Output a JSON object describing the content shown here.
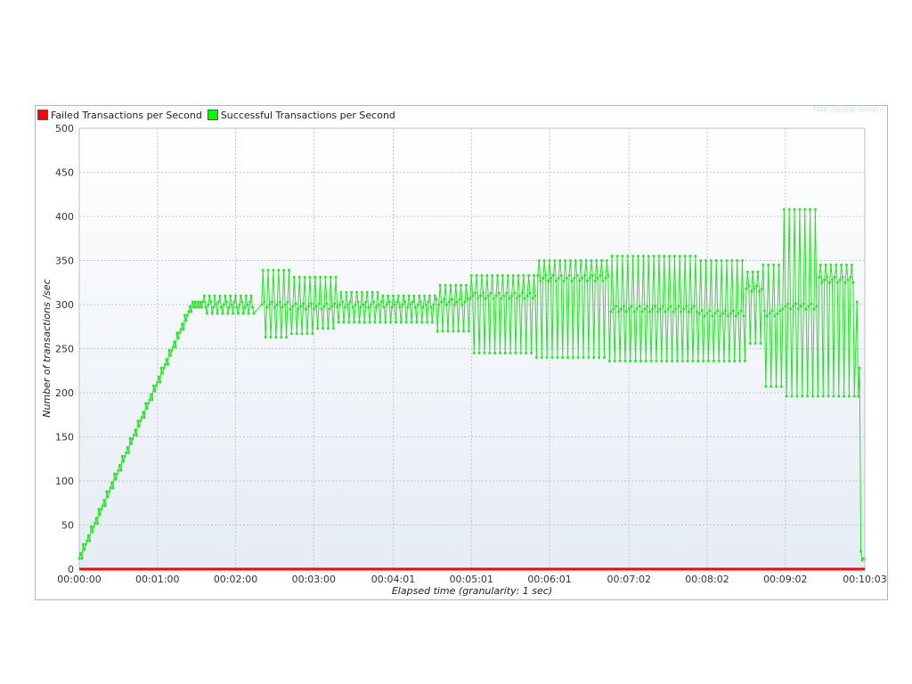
{
  "legend": {
    "failed": "Failed Transactions per Second",
    "successful": "Successful Transactions per Second"
  },
  "watermark": "http://jp@gc/plugins",
  "colors": {
    "failed": "#ff0000",
    "successful": "#00ff00",
    "successful_line": "#22e622",
    "plot_bg_top": "#ffffff",
    "plot_bg_bottom": "#e6ecf5",
    "grid": "#c4c8cc"
  },
  "chart_data": {
    "type": "line",
    "title": "",
    "xlabel": "Elapsed time (granularity: 1 sec)",
    "ylabel": "Number of transactions /sec",
    "ylim": [
      0,
      500
    ],
    "xlim_seconds": [
      0,
      603
    ],
    "grid": true,
    "legend_position": "top-left",
    "y_ticks": [
      "0",
      "50",
      "100",
      "150",
      "200",
      "250",
      "300",
      "350",
      "400",
      "450",
      "500"
    ],
    "x_ticks": [
      {
        "label": "00:00:00",
        "t": 0
      },
      {
        "label": "00:01:00",
        "t": 60
      },
      {
        "label": "00:02:00",
        "t": 120
      },
      {
        "label": "00:03:00",
        "t": 180
      },
      {
        "label": "00:04:01",
        "t": 241
      },
      {
        "label": "00:05:01",
        "t": 301
      },
      {
        "label": "00:06:01",
        "t": 361
      },
      {
        "label": "00:07:02",
        "t": 422
      },
      {
        "label": "00:08:02",
        "t": 482
      },
      {
        "label": "00:09:02",
        "t": 542
      },
      {
        "label": "00:10:03",
        "t": 603
      }
    ],
    "series": [
      {
        "name": "Failed Transactions per Second",
        "segments": [
          {
            "t0": 0,
            "t1": 603,
            "value": 0
          }
        ]
      },
      {
        "name": "Successful Transactions per Second",
        "ramp": {
          "t0": 0,
          "t1": 95,
          "v0": 15,
          "v1": 300,
          "step_seconds": 3,
          "step_size": 10
        },
        "segments": [
          {
            "t0": 95,
            "t1": 135,
            "low": 290,
            "high": 310,
            "mid": 300
          },
          {
            "t0": 140,
            "t1": 162,
            "low": 263,
            "high": 339,
            "mid": 300
          },
          {
            "t0": 162,
            "t1": 183,
            "low": 267,
            "high": 331,
            "mid": 298
          },
          {
            "t0": 183,
            "t1": 198,
            "low": 273,
            "high": 331,
            "mid": 298
          },
          {
            "t0": 198,
            "t1": 232,
            "low": 280,
            "high": 314,
            "mid": 300
          },
          {
            "t0": 232,
            "t1": 274,
            "low": 280,
            "high": 310,
            "mid": 300
          },
          {
            "t0": 274,
            "t1": 300,
            "low": 270,
            "high": 322,
            "mid": 303
          },
          {
            "t0": 300,
            "t1": 351,
            "low": 245,
            "high": 333,
            "mid": 310
          },
          {
            "t0": 351,
            "t1": 407,
            "low": 240,
            "high": 350,
            "mid": 330
          },
          {
            "t0": 407,
            "t1": 476,
            "low": 236,
            "high": 355,
            "mid": 295
          },
          {
            "t0": 476,
            "t1": 512,
            "low": 236,
            "high": 350,
            "mid": 290
          },
          {
            "t0": 512,
            "t1": 525,
            "low": 256,
            "high": 337,
            "mid": 318
          },
          {
            "t0": 525,
            "t1": 540,
            "low": 207,
            "high": 345,
            "mid": 290
          },
          {
            "t0": 540,
            "t1": 567,
            "low": 196,
            "high": 408,
            "mid": 298
          },
          {
            "t0": 567,
            "t1": 596,
            "low": 196,
            "high": 345,
            "mid": 328
          }
        ],
        "tail": [
          {
            "t": 597,
            "v": 303
          },
          {
            "t": 598,
            "v": 196
          },
          {
            "t": 599,
            "v": 228
          },
          {
            "t": 600,
            "v": 20
          },
          {
            "t": 601,
            "v": 10
          },
          {
            "t": 602,
            "v": 12
          }
        ]
      }
    ]
  }
}
